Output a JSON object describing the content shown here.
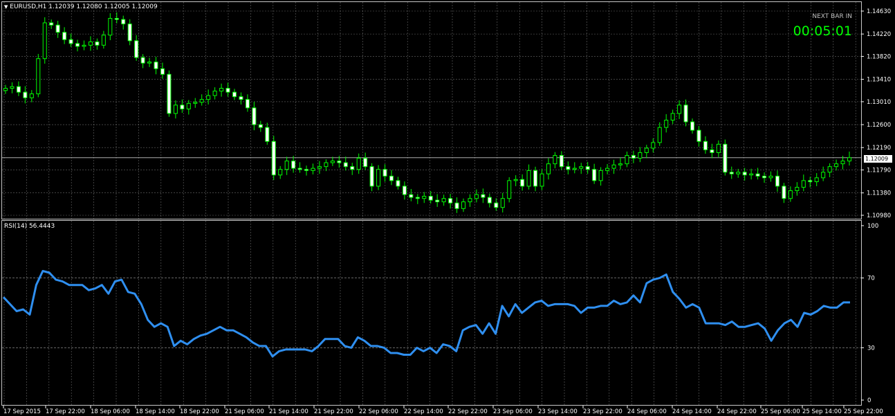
{
  "header": {
    "symbol_line": "EURUSD,H1  1.12039 1.12080 1.12005 1.12009",
    "dropdown_icon": "triangle-down-icon"
  },
  "indicator": {
    "label": "RSI(14) 56.4443"
  },
  "timer": {
    "label": "NEXT BAR IN",
    "value": "00:05:01"
  },
  "price_tag": "1.12009",
  "colors": {
    "background": "#000000",
    "grid": "#c0c0c0",
    "candle": "#00ff00",
    "rsi_line": "#2f8ff0",
    "countdown": "#00ff00"
  },
  "chart_data": [
    {
      "type": "candlestick",
      "title": "",
      "price_axis_ticks": [
        "1.14630",
        "1.14220",
        "1.13820",
        "1.13410",
        "1.13010",
        "1.12600",
        "1.12190",
        "1.11790",
        "1.11380",
        "1.10980"
      ],
      "ylim": [
        1.1098,
        1.1463
      ],
      "current_price": 1.12009,
      "time_axis_ticks": [
        "17 Sep 2015",
        "17 Sep 22:00",
        "18 Sep 06:00",
        "18 Sep 14:00",
        "18 Sep 22:00",
        "21 Sep 06:00",
        "21 Sep 14:00",
        "21 Sep 22:00",
        "22 Sep 06:00",
        "22 Sep 14:00",
        "22 Sep 22:00",
        "23 Sep 06:00",
        "23 Sep 14:00",
        "23 Sep 22:00",
        "24 Sep 06:00",
        "24 Sep 14:00",
        "24 Sep 22:00",
        "25 Sep 06:00",
        "25 Sep 14:00",
        "25 Sep 22:00"
      ],
      "close_series_approx": [
        1.1325,
        1.1328,
        1.1318,
        1.1308,
        1.1315,
        1.1378,
        1.1442,
        1.1438,
        1.1425,
        1.1412,
        1.1405,
        1.14,
        1.1402,
        1.1408,
        1.1402,
        1.142,
        1.145,
        1.1448,
        1.144,
        1.141,
        1.138,
        1.137,
        1.1372,
        1.136,
        1.135,
        1.128,
        1.1295,
        1.1288,
        1.1298,
        1.13,
        1.1305,
        1.1312,
        1.132,
        1.1325,
        1.1318,
        1.131,
        1.1305,
        1.129,
        1.126,
        1.1255,
        1.123,
        1.117,
        1.118,
        1.1195,
        1.1182,
        1.118,
        1.1178,
        1.1182,
        1.1185,
        1.1192,
        1.1195,
        1.1192,
        1.1185,
        1.118,
        1.12,
        1.1185,
        1.115,
        1.118,
        1.1168,
        1.116,
        1.115,
        1.1135,
        1.113,
        1.1128,
        1.1132,
        1.1125,
        1.1122,
        1.1128,
        1.112,
        1.111,
        1.1122,
        1.1128,
        1.1135,
        1.113,
        1.112,
        1.1112,
        1.1128,
        1.116,
        1.1162,
        1.115,
        1.1178,
        1.115,
        1.1172,
        1.119,
        1.1205,
        1.1185,
        1.118,
        1.1182,
        1.1185,
        1.118,
        1.116,
        1.1178,
        1.1182,
        1.1188,
        1.119,
        1.1205,
        1.12,
        1.121,
        1.1218,
        1.1228,
        1.1255,
        1.1268,
        1.128,
        1.1295,
        1.1265,
        1.125,
        1.123,
        1.1215,
        1.121,
        1.1225,
        1.1175,
        1.1172,
        1.1175,
        1.117,
        1.1172,
        1.1168,
        1.1165,
        1.1168,
        1.115,
        1.1128,
        1.1142,
        1.1148,
        1.116,
        1.1158,
        1.1165,
        1.1175,
        1.1185,
        1.119,
        1.1195,
        1.1201
      ]
    },
    {
      "type": "line",
      "title": "",
      "name": "RSI(14)",
      "last_value": 56.4443,
      "ylim": [
        0,
        100
      ],
      "y_ticks": [
        "100",
        "70",
        "30",
        "0"
      ],
      "levels": [
        70,
        30
      ],
      "values": [
        59,
        55,
        51,
        52,
        49,
        66,
        74,
        73,
        69,
        68,
        66,
        66,
        66,
        63,
        64,
        66,
        61,
        68,
        69,
        62,
        61,
        55,
        46,
        42,
        44,
        42,
        31,
        34,
        32,
        35,
        37,
        38,
        40,
        42,
        40,
        40,
        38,
        36,
        33,
        31,
        31,
        25,
        28,
        29,
        29,
        29,
        29,
        28,
        31,
        35,
        35,
        35,
        31,
        30,
        36,
        34,
        31,
        31,
        30,
        27,
        27,
        26,
        26,
        30,
        28,
        30,
        27,
        32,
        31,
        28,
        40,
        42,
        43,
        38,
        44,
        38,
        54,
        48,
        55,
        50,
        53,
        56,
        57,
        54,
        55,
        55,
        55,
        54,
        50,
        53,
        53,
        54,
        54,
        57,
        55,
        56,
        60,
        56,
        67,
        69,
        70,
        72,
        62,
        58,
        53,
        55,
        53,
        44,
        44,
        44,
        43,
        45,
        42,
        42,
        43,
        44,
        41,
        34,
        40,
        44,
        46,
        42,
        50,
        49,
        51,
        54,
        53,
        53,
        56,
        56
      ]
    }
  ]
}
